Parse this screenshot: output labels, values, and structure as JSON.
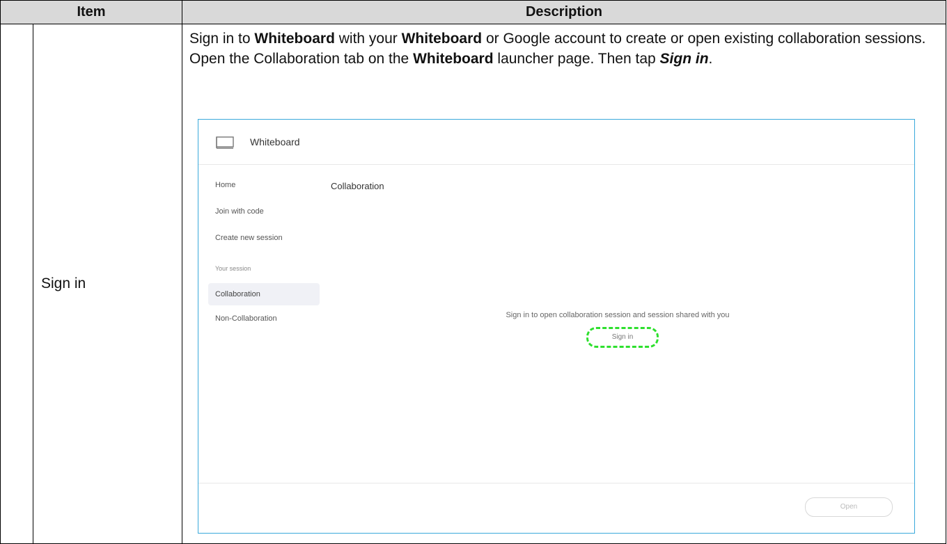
{
  "table": {
    "header_item": "Item",
    "header_description": "Description"
  },
  "row": {
    "item_label": "Sign in",
    "desc_part1": "Sign in to ",
    "desc_whiteboard1": "Whiteboard",
    "desc_part2": " with your ",
    "desc_whiteboard2": "Whiteboard",
    "desc_part3": " or Google account to create or open existing collaboration sessions. Open the Collaboration tab on the ",
    "desc_whiteboard3": "Whiteboard",
    "desc_part4": " launcher page. Then tap ",
    "desc_signin": "Sign in",
    "desc_part5": "."
  },
  "screenshot": {
    "app_title": "Whiteboard",
    "app_icon": "monitor-icon",
    "sidebar_items": [
      {
        "label": "Home"
      },
      {
        "label": "Join with code"
      },
      {
        "label": "Create new session"
      },
      {
        "label": "Your session"
      },
      {
        "label": "Collaboration"
      },
      {
        "label": "Non-Collaboration"
      }
    ],
    "content_title": "Collaboration",
    "signin_message": "Sign in to open collaboration session and session shared with you",
    "signin_button": "Sign in",
    "footer_button": "Open",
    "border_color": "#39a9db",
    "highlight_color": "#2ee02e"
  }
}
